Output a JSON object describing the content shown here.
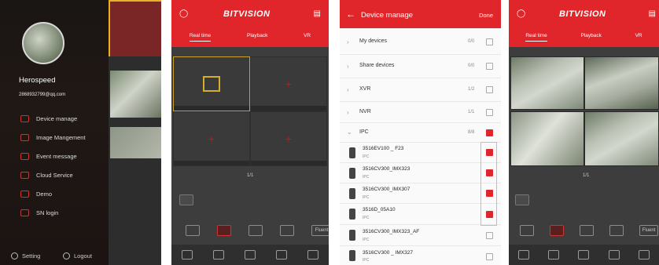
{
  "screen1": {
    "user_name": "Herospeed",
    "email": "2868932799@qq.com",
    "menu": [
      {
        "label": "Device manage",
        "icon": "device-icon"
      },
      {
        "label": "Image Mangement",
        "icon": "image-icon"
      },
      {
        "label": "Event message",
        "icon": "bell-icon"
      },
      {
        "label": "Cloud Service",
        "icon": "cloud-icon"
      },
      {
        "label": "Demo",
        "icon": "demo-icon"
      },
      {
        "label": "SN login",
        "icon": "sn-login-icon"
      }
    ],
    "setting_label": "Setting",
    "logout_label": "Logout"
  },
  "screen2": {
    "logo": "BITVISION",
    "tabs": [
      "Real time",
      "Playback",
      "VR"
    ],
    "pager": "1/1",
    "fluent": "Fluent"
  },
  "screen3": {
    "title": "Device manage",
    "done": "Done",
    "groups": [
      {
        "label": "My devices",
        "count": "0/0",
        "checked": false,
        "expanded": false
      },
      {
        "label": "Share devices",
        "count": "0/0",
        "checked": false,
        "expanded": false
      },
      {
        "label": "XVR",
        "count": "1/2",
        "checked": false,
        "expanded": false
      },
      {
        "label": "NVR",
        "count": "1/1",
        "checked": false,
        "expanded": false
      },
      {
        "label": "IPC",
        "count": "8/8",
        "checked": true,
        "expanded": true
      }
    ],
    "devices": [
      {
        "name": "3516EV100 _ F23",
        "sub": "IPC",
        "checked": true
      },
      {
        "name": "3516CV300_IMX323",
        "sub": "IPC",
        "checked": true
      },
      {
        "name": "3516CV300_IMX307",
        "sub": "IPC",
        "checked": true
      },
      {
        "name": "3516D_05A10",
        "sub": "IPC",
        "checked": true
      },
      {
        "name": "3516CV300_IMX323_AF",
        "sub": "IPC",
        "checked": false
      },
      {
        "name": "3516CV300 _ IMX327",
        "sub": "IPC",
        "checked": false
      }
    ]
  },
  "screen4": {
    "logo": "BITVISION",
    "tabs": [
      "Real time",
      "Playback",
      "VR"
    ],
    "pager": "1/1",
    "fluent": "Fluent"
  },
  "colors": {
    "accent": "#e0262a",
    "highlight": "#d7ae2a",
    "dark_bg": "#3d3d3d"
  }
}
